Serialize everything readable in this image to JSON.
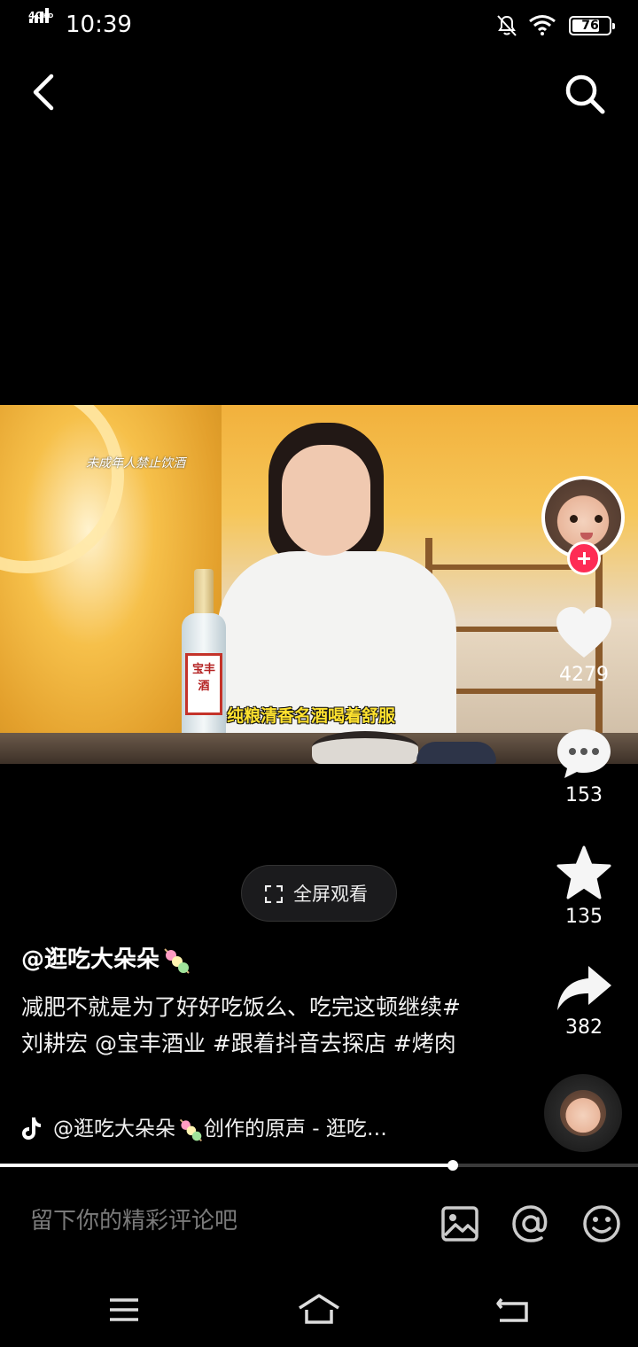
{
  "status_bar": {
    "network": "4G",
    "network_sup": "HD",
    "time": "10:39",
    "battery": "76",
    "battery_level": 0.76
  },
  "video": {
    "warning_tag": "未成年人禁止饮酒",
    "subtitle": "纯粮清香名酒喝着舒服",
    "bottle_label": "宝丰酒"
  },
  "actions": {
    "likes": "4279",
    "comments": "153",
    "favorites": "135",
    "shares": "382"
  },
  "fullscreen_label": "全屏观看",
  "author": "@逛吃大朵朵",
  "description": "减肥不就是为了好好吃饭么、吃完这顿继续#刘耕宏 @宝丰酒业 #跟着抖音去探店 #烤肉",
  "music": {
    "prefix": "@逛吃大朵朵",
    "suffix": "创作的原声 - 逛吃…"
  },
  "progress": 0.71,
  "comment_placeholder": "留下你的精彩评论吧",
  "colors": {
    "follow": "#fe2c55",
    "subtitle": "#ffe22f",
    "background": "#000000"
  }
}
